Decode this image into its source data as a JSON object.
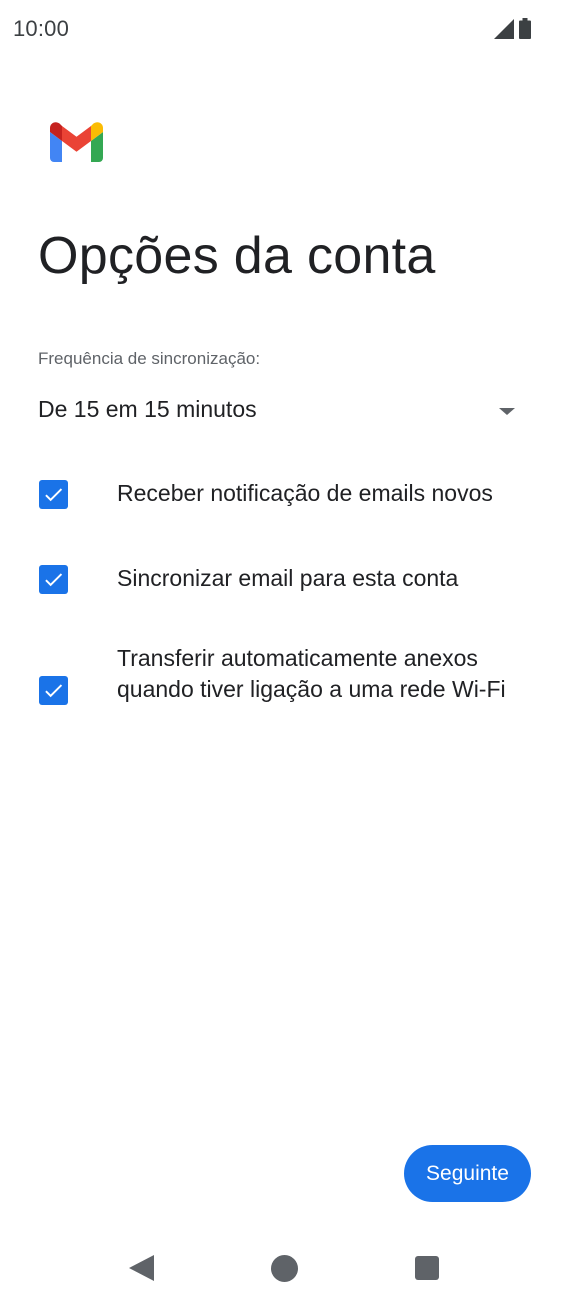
{
  "status_bar": {
    "time": "10:00",
    "icons": [
      "signal-icon",
      "battery-icon"
    ]
  },
  "app": {
    "logo": "gmail-logo",
    "colors": {
      "accent": "#1a73e8",
      "text_primary": "#202124",
      "text_secondary": "#5f6368"
    }
  },
  "page": {
    "title": "Opções da conta"
  },
  "sync": {
    "label": "Frequência de sincronização:",
    "selected": "De 15 em 15 minutos"
  },
  "options": [
    {
      "label": "Receber notificação de emails novos",
      "checked": true
    },
    {
      "label": "Sincronizar email para esta conta",
      "checked": true
    },
    {
      "label": "Transferir automaticamente anexos quando tiver ligação a uma rede Wi-Fi",
      "checked": true
    }
  ],
  "footer": {
    "next_label": "Seguinte"
  },
  "nav": {
    "icons": [
      "back-icon",
      "home-icon",
      "recents-icon"
    ]
  }
}
